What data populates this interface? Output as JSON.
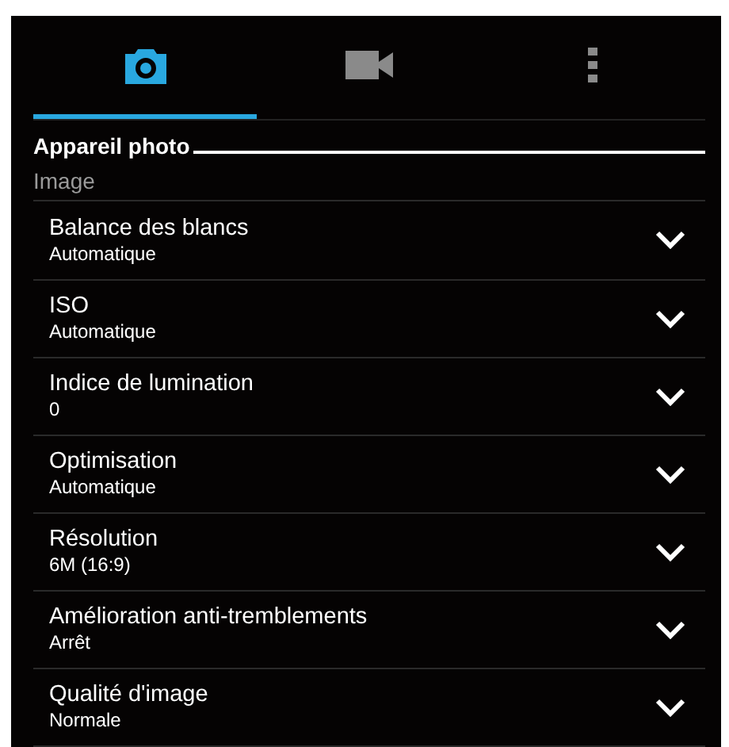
{
  "tabs": [
    {
      "kind": "camera",
      "selected": true
    },
    {
      "kind": "video",
      "selected": false
    },
    {
      "kind": "more",
      "selected": false
    }
  ],
  "section_title": "Appareil photo",
  "group_label": "Image",
  "settings": [
    {
      "title": "Balance des blancs",
      "value": "Automatique"
    },
    {
      "title": "ISO",
      "value": "Automatique"
    },
    {
      "title": "Indice de lumination",
      "value": "0"
    },
    {
      "title": "Optimisation",
      "value": "Automatique"
    },
    {
      "title": "Résolution",
      "value": "6M (16:9)"
    },
    {
      "title": "Amélioration anti-tremblements",
      "value": "Arrêt"
    },
    {
      "title": "Qualité d'image",
      "value": "Normale"
    }
  ]
}
